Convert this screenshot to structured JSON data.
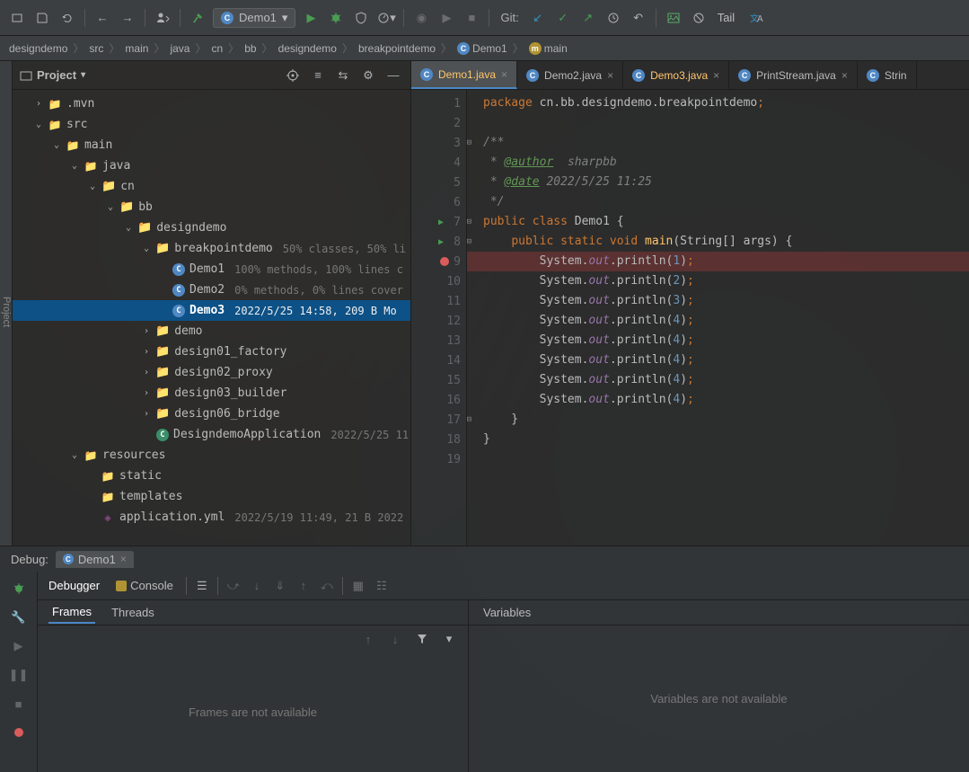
{
  "toolbar": {
    "run_config": "Demo1",
    "git_label": "Git:",
    "tail_label": "Tail"
  },
  "breadcrumb": [
    "designdemo",
    "src",
    "main",
    "java",
    "cn",
    "bb",
    "designdemo",
    "breakpointdemo",
    "Demo1",
    "main"
  ],
  "project_panel": {
    "title": "Project"
  },
  "tree": {
    "mvn": ".mvn",
    "src": "src",
    "main": "main",
    "java": "java",
    "cn": "cn",
    "bb": "bb",
    "designdemo": "designdemo",
    "breakpointdemo": "breakpointdemo",
    "breakpointdemo_cov": "50% classes, 50% li",
    "demo1": "Demo1",
    "demo1_cov": "100% methods, 100% lines c",
    "demo2": "Demo2",
    "demo2_cov": "0% methods, 0% lines cover",
    "demo3": "Demo3",
    "demo3_cov": "2022/5/25 14:58, 209 B Mo",
    "demo": "demo",
    "design01": "design01_factory",
    "design02": "design02_proxy",
    "design03": "design03_builder",
    "design06": "design06_bridge",
    "app": "DesigndemoApplication",
    "app_cov": "2022/5/25 11",
    "resources": "resources",
    "static": "static",
    "templates": "templates",
    "appyml": "application.yml",
    "appyml_cov": "2022/5/19 11:49, 21 B 2022"
  },
  "tabs": {
    "t1": "Demo1.java",
    "t2": "Demo2.java",
    "t3": "Demo3.java",
    "t4": "PrintStream.java",
    "t5": "Strin"
  },
  "code": {
    "pkg_kw": "package",
    "pkg_path": "cn.bb.designdemo.breakpointdemo",
    "doc_open": "/**",
    "author_tag": "@author",
    "author_val": "sharpbb",
    "date_tag": "@date",
    "date_val": "2022/5/25 11:25",
    "doc_close": " */",
    "public": "public",
    "class": "class",
    "classname": "Demo1",
    "static": "static",
    "void": "void",
    "main": "main",
    "params": "(String[] args)",
    "System": "System",
    "out": "out",
    "println": "println",
    "v1": "1",
    "v2": "2",
    "v3": "3",
    "v4": "4"
  },
  "debug": {
    "panel_label": "Debug:",
    "tab_name": "Demo1",
    "debugger_tab": "Debugger",
    "console_tab": "Console",
    "frames_tab": "Frames",
    "threads_tab": "Threads",
    "vars_tab": "Variables",
    "frames_empty": "Frames are not available",
    "vars_empty": "Variables are not available"
  }
}
